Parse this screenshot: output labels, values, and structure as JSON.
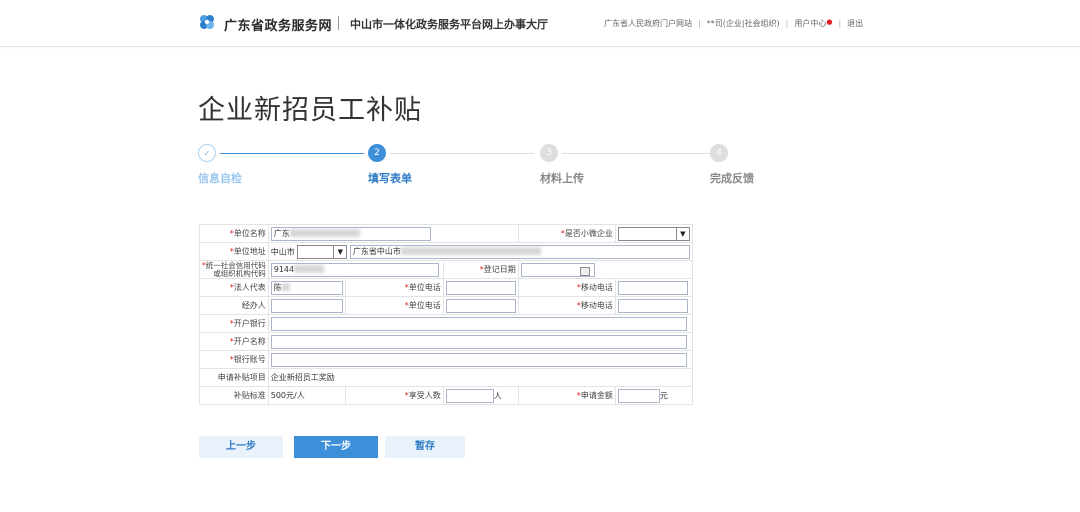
{
  "header": {
    "site_name": "广东省政务服务网",
    "hall_name": "中山市一体化政务服务平台网上办事大厅",
    "links": [
      {
        "label": "广东省人民政府门户网站"
      },
      {
        "label": "**司(企业|社会组织)"
      },
      {
        "label": "用户中心"
      },
      {
        "label": "退出"
      }
    ]
  },
  "page": {
    "title": "企业新招员工补贴"
  },
  "steps": [
    {
      "number": "✓",
      "label": "信息自检",
      "state": "done"
    },
    {
      "number": "2",
      "label": "填写表单",
      "state": "active"
    },
    {
      "number": "3",
      "label": "材料上传",
      "state": "todo"
    },
    {
      "number": "4",
      "label": "完成反馈",
      "state": "todo"
    }
  ],
  "form": {
    "unit_name_label": "单位名称",
    "unit_name_value": "广东",
    "small_micro_label": "是否小微企业",
    "unit_address_label": "单位地址",
    "city_value": "中山市",
    "address_value": "广东省中山市",
    "credit_code_label_line1": "统一社会信用代码",
    "credit_code_label_line2": "或组织机构代码",
    "credit_code_value": "9144",
    "reg_date_label": "登记日期",
    "legal_rep_label": "法人代表",
    "legal_rep_value": "陈",
    "unit_phone_label": "单位电话",
    "mobile_label": "移动电话",
    "handler_label": "经办人",
    "bank_label": "开户银行",
    "account_name_label": "开户名称",
    "account_no_label": "银行账号",
    "project_label": "申请补贴项目",
    "project_value": "企业新招员工奖励",
    "standard_label": "补贴标准",
    "standard_value": "500元/人",
    "people_label": "享受人数",
    "people_unit": "人",
    "amount_label": "申请金额",
    "amount_unit": "元"
  },
  "buttons": {
    "prev": "上一步",
    "next": "下一步",
    "save": "暂存"
  },
  "colors": {
    "accent": "#3d8fd9",
    "done_step": "#8fc1ea",
    "required": "#e02020"
  }
}
